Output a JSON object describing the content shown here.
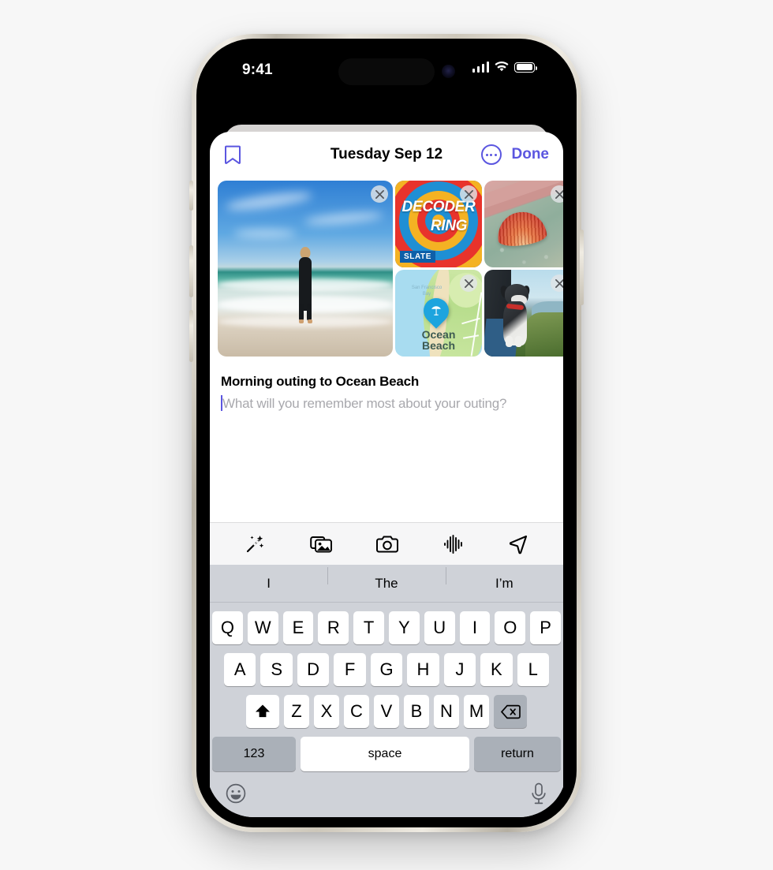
{
  "status_bar": {
    "time": "9:41",
    "cellular_icon": "signal-bars-icon",
    "wifi_icon": "wifi-icon",
    "battery_icon": "battery-icon"
  },
  "nav": {
    "bookmark_icon": "bookmark-icon",
    "title": "Tuesday Sep 12",
    "more_icon": "more-ellipsis-icon",
    "done_label": "Done"
  },
  "attachments": [
    {
      "name": "beach-surfer-photo",
      "caption": "",
      "close_label": "✕"
    },
    {
      "name": "decoder-ring-podcast-artwork",
      "line1": "DECODER",
      "line2": "RING",
      "brand": "SLATE",
      "close_label": "✕"
    },
    {
      "name": "seashell-photo",
      "caption": "",
      "close_label": "✕"
    },
    {
      "name": "ocean-beach-map",
      "bay_label": "San Francisco Bay",
      "place_label_line1": "Ocean",
      "place_label_line2": "Beach",
      "close_label": "✕"
    },
    {
      "name": "dog-car-window-photo",
      "caption": "",
      "close_label": "✕"
    }
  ],
  "note": {
    "title": "Morning outing to Ocean Beach",
    "placeholder": "What will you remember most about your outing?"
  },
  "toolbar": [
    {
      "name": "magic-wand-icon",
      "label": "Markup"
    },
    {
      "name": "photo-library-icon",
      "label": "Photos"
    },
    {
      "name": "camera-icon",
      "label": "Camera"
    },
    {
      "name": "audio-waveform-icon",
      "label": "Audio"
    },
    {
      "name": "location-arrow-icon",
      "label": "Location"
    }
  ],
  "keyboard": {
    "predictions": [
      "I",
      "The",
      "I’m"
    ],
    "row1": [
      "Q",
      "W",
      "E",
      "R",
      "T",
      "Y",
      "U",
      "I",
      "O",
      "P"
    ],
    "row2": [
      "A",
      "S",
      "D",
      "F",
      "G",
      "H",
      "J",
      "K",
      "L"
    ],
    "row3": [
      "Z",
      "X",
      "C",
      "V",
      "B",
      "N",
      "M"
    ],
    "shift_icon": "shift-arrow-icon",
    "delete_icon": "delete-backspace-icon",
    "numbers_label": "123",
    "space_label": "space",
    "return_label": "return",
    "emoji_icon": "emoji-smiley-icon",
    "dictation_icon": "microphone-icon"
  },
  "colors": {
    "accent": "#5b56e0",
    "keyboard_bg": "#cfd2d8",
    "key_bg": "#ffffff",
    "key_special_bg": "#aab0b8",
    "placeholder_text": "#a8a8ad",
    "toolbar_bg": "#f6f6f7"
  }
}
